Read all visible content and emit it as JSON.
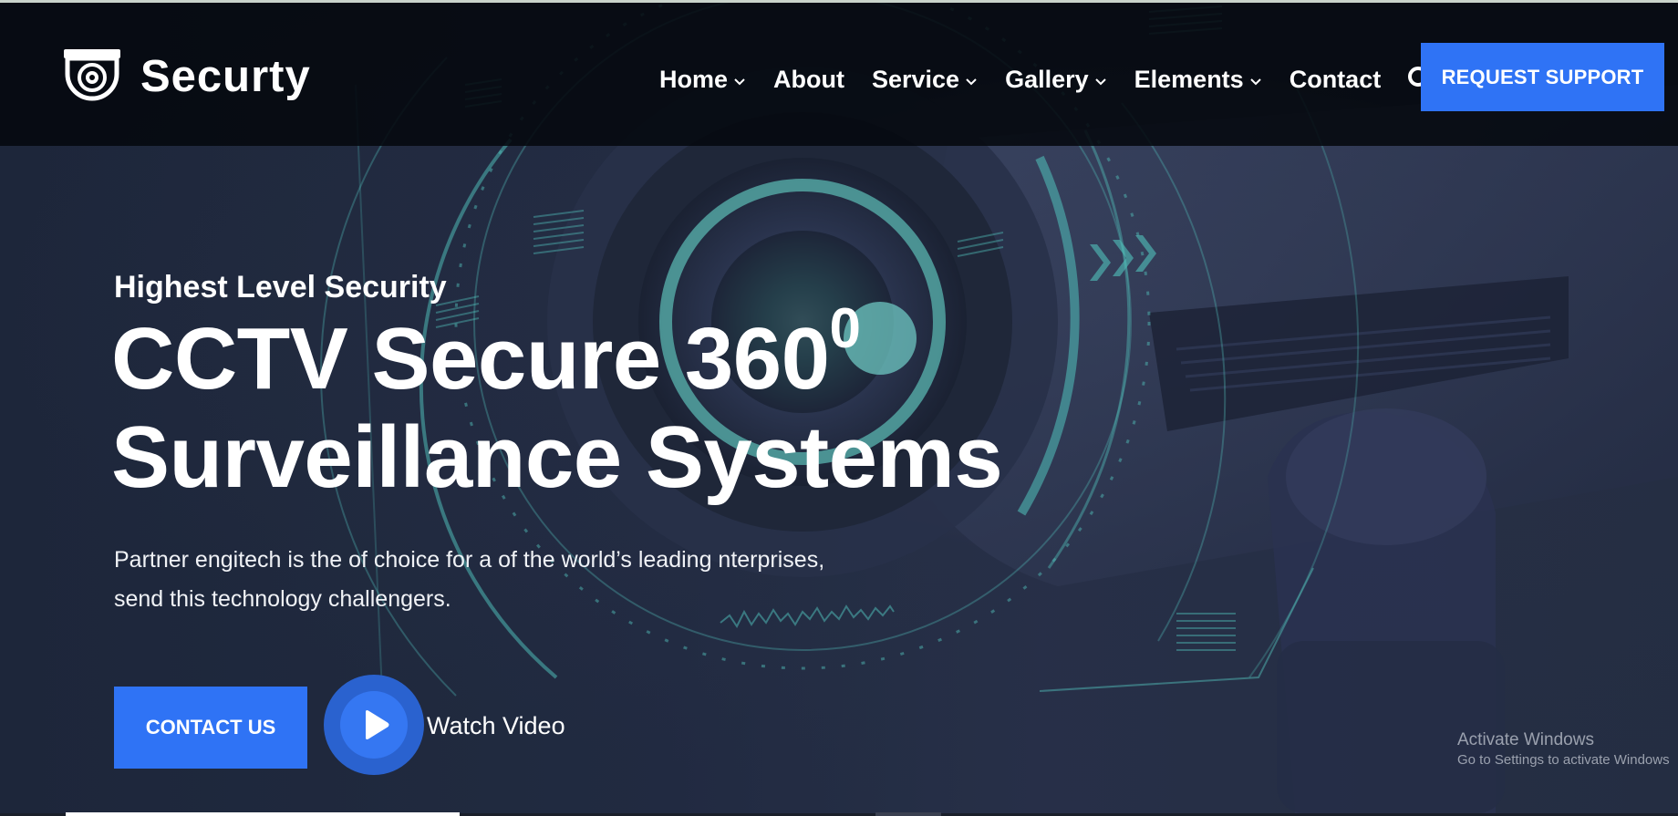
{
  "brand": {
    "name": "Securty",
    "icon": "cctv-camera-logo-icon"
  },
  "nav": {
    "items": [
      {
        "label": "Home",
        "has_dropdown": true
      },
      {
        "label": "About",
        "has_dropdown": false
      },
      {
        "label": "Service",
        "has_dropdown": true
      },
      {
        "label": "Gallery",
        "has_dropdown": true
      },
      {
        "label": "Elements",
        "has_dropdown": true
      },
      {
        "label": "Contact",
        "has_dropdown": false
      }
    ],
    "search_icon": "search-icon",
    "cta_label": "REQUEST SUPPORT"
  },
  "hero": {
    "eyebrow": "Highest Level Security",
    "title_line1": "CCTV Secure 360",
    "title_sup": "0",
    "title_line2": "Surveillance Systems",
    "description_line1": "Partner engitech is the of choice for a of the world’s leading nterprises,",
    "description_line2": "send this technology challengers.",
    "contact_label": "CONTACT US",
    "video_label": "Watch Video",
    "play_icon": "play-icon"
  },
  "watermark": {
    "line1": "Activate Windows",
    "line2": "Go to Settings to activate Windows"
  },
  "colors": {
    "accent": "#2f73f5",
    "navbar_bg": "#05080e",
    "hero_bg": "#222b40",
    "hud_teal": "#4fb8b4"
  }
}
